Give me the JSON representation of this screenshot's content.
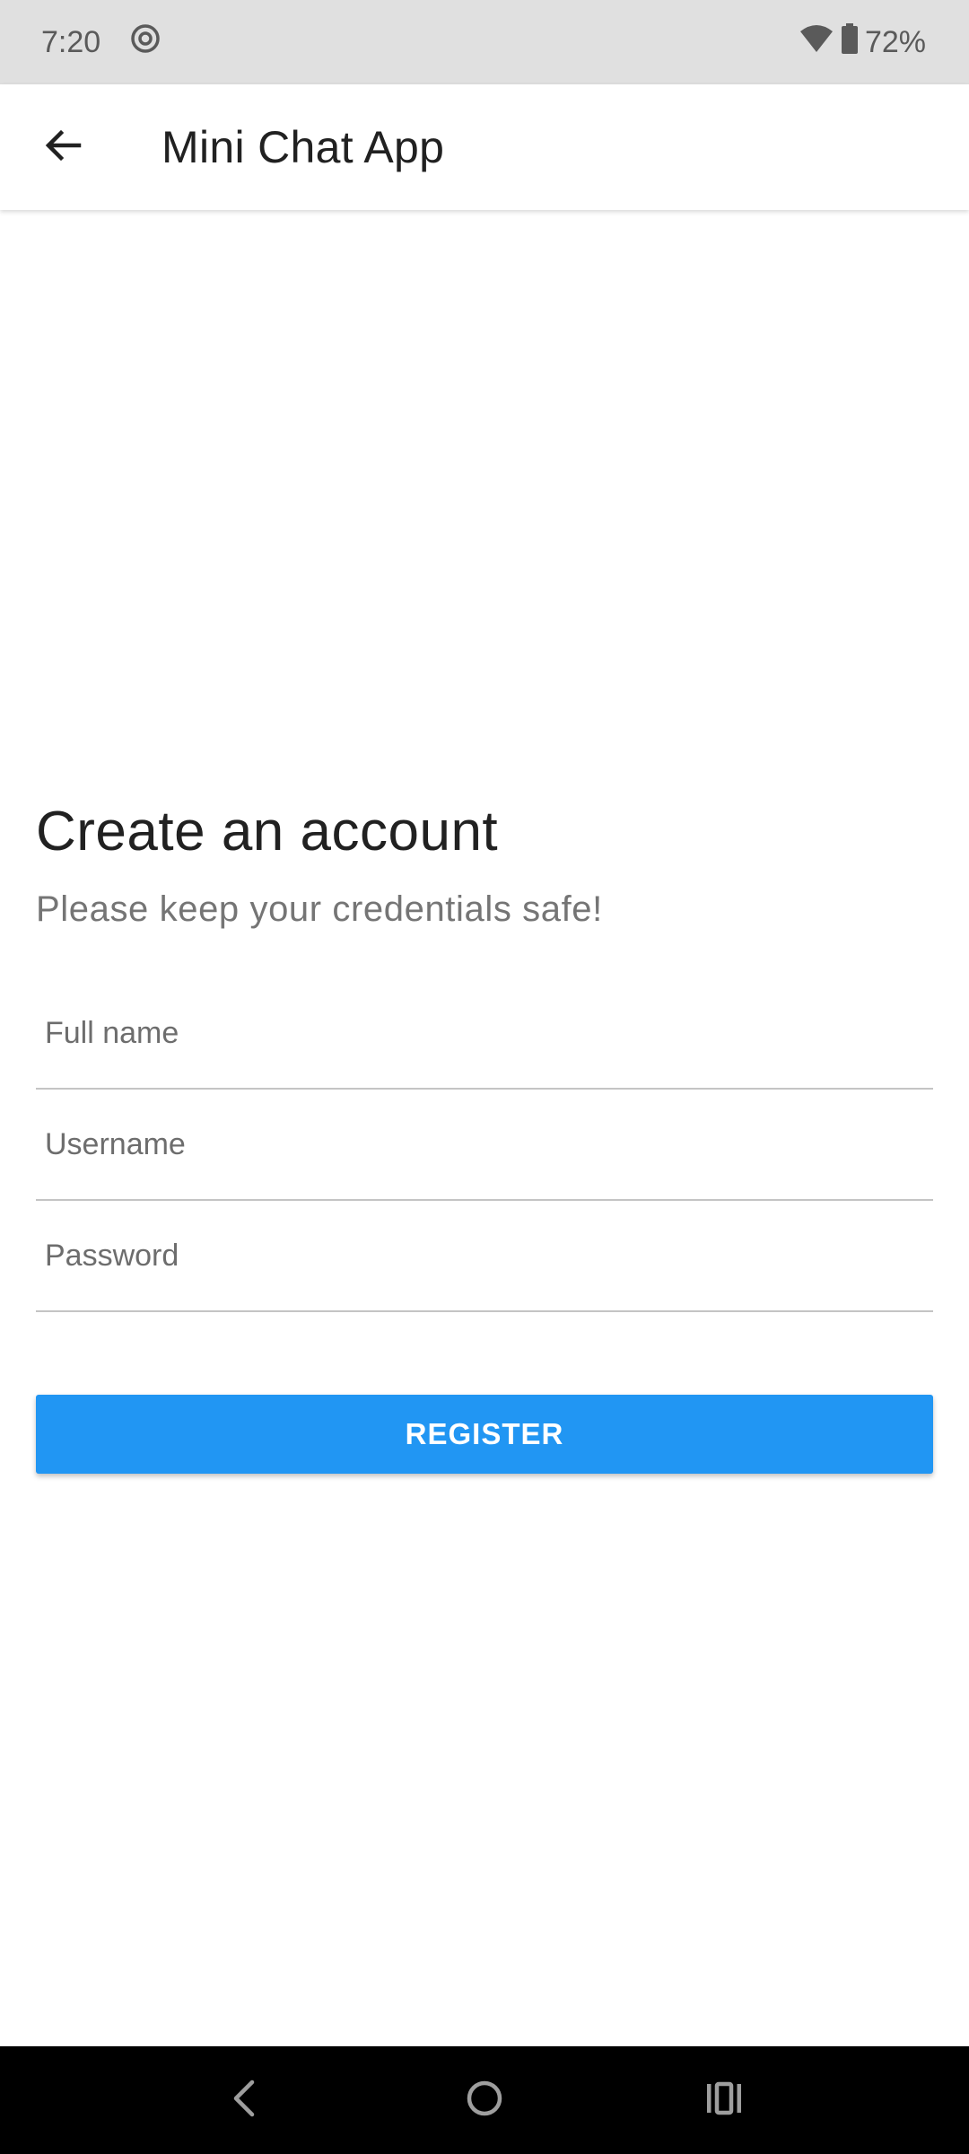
{
  "status_bar": {
    "time": "7:20",
    "battery_percent": "72%",
    "icons": [
      "screen-record-icon",
      "wifi-icon",
      "battery-icon"
    ]
  },
  "app_bar": {
    "title": "Mini Chat App",
    "back_icon": "arrow-left-icon"
  },
  "form": {
    "title": "Create an account",
    "subtitle": "Please keep your credentials safe!",
    "fields": [
      {
        "placeholder": "Full name",
        "value": ""
      },
      {
        "placeholder": "Username",
        "value": ""
      },
      {
        "placeholder": "Password",
        "value": ""
      }
    ],
    "register_label": "REGISTER"
  },
  "nav_bar": {
    "icons": [
      "nav-back-icon",
      "nav-home-icon",
      "nav-recents-icon"
    ]
  },
  "colors": {
    "status_bar_bg": "#e0e0e0",
    "accent": "#2196f3",
    "text_primary": "#212121",
    "text_secondary": "#757575",
    "nav_bar_bg": "#000000"
  }
}
